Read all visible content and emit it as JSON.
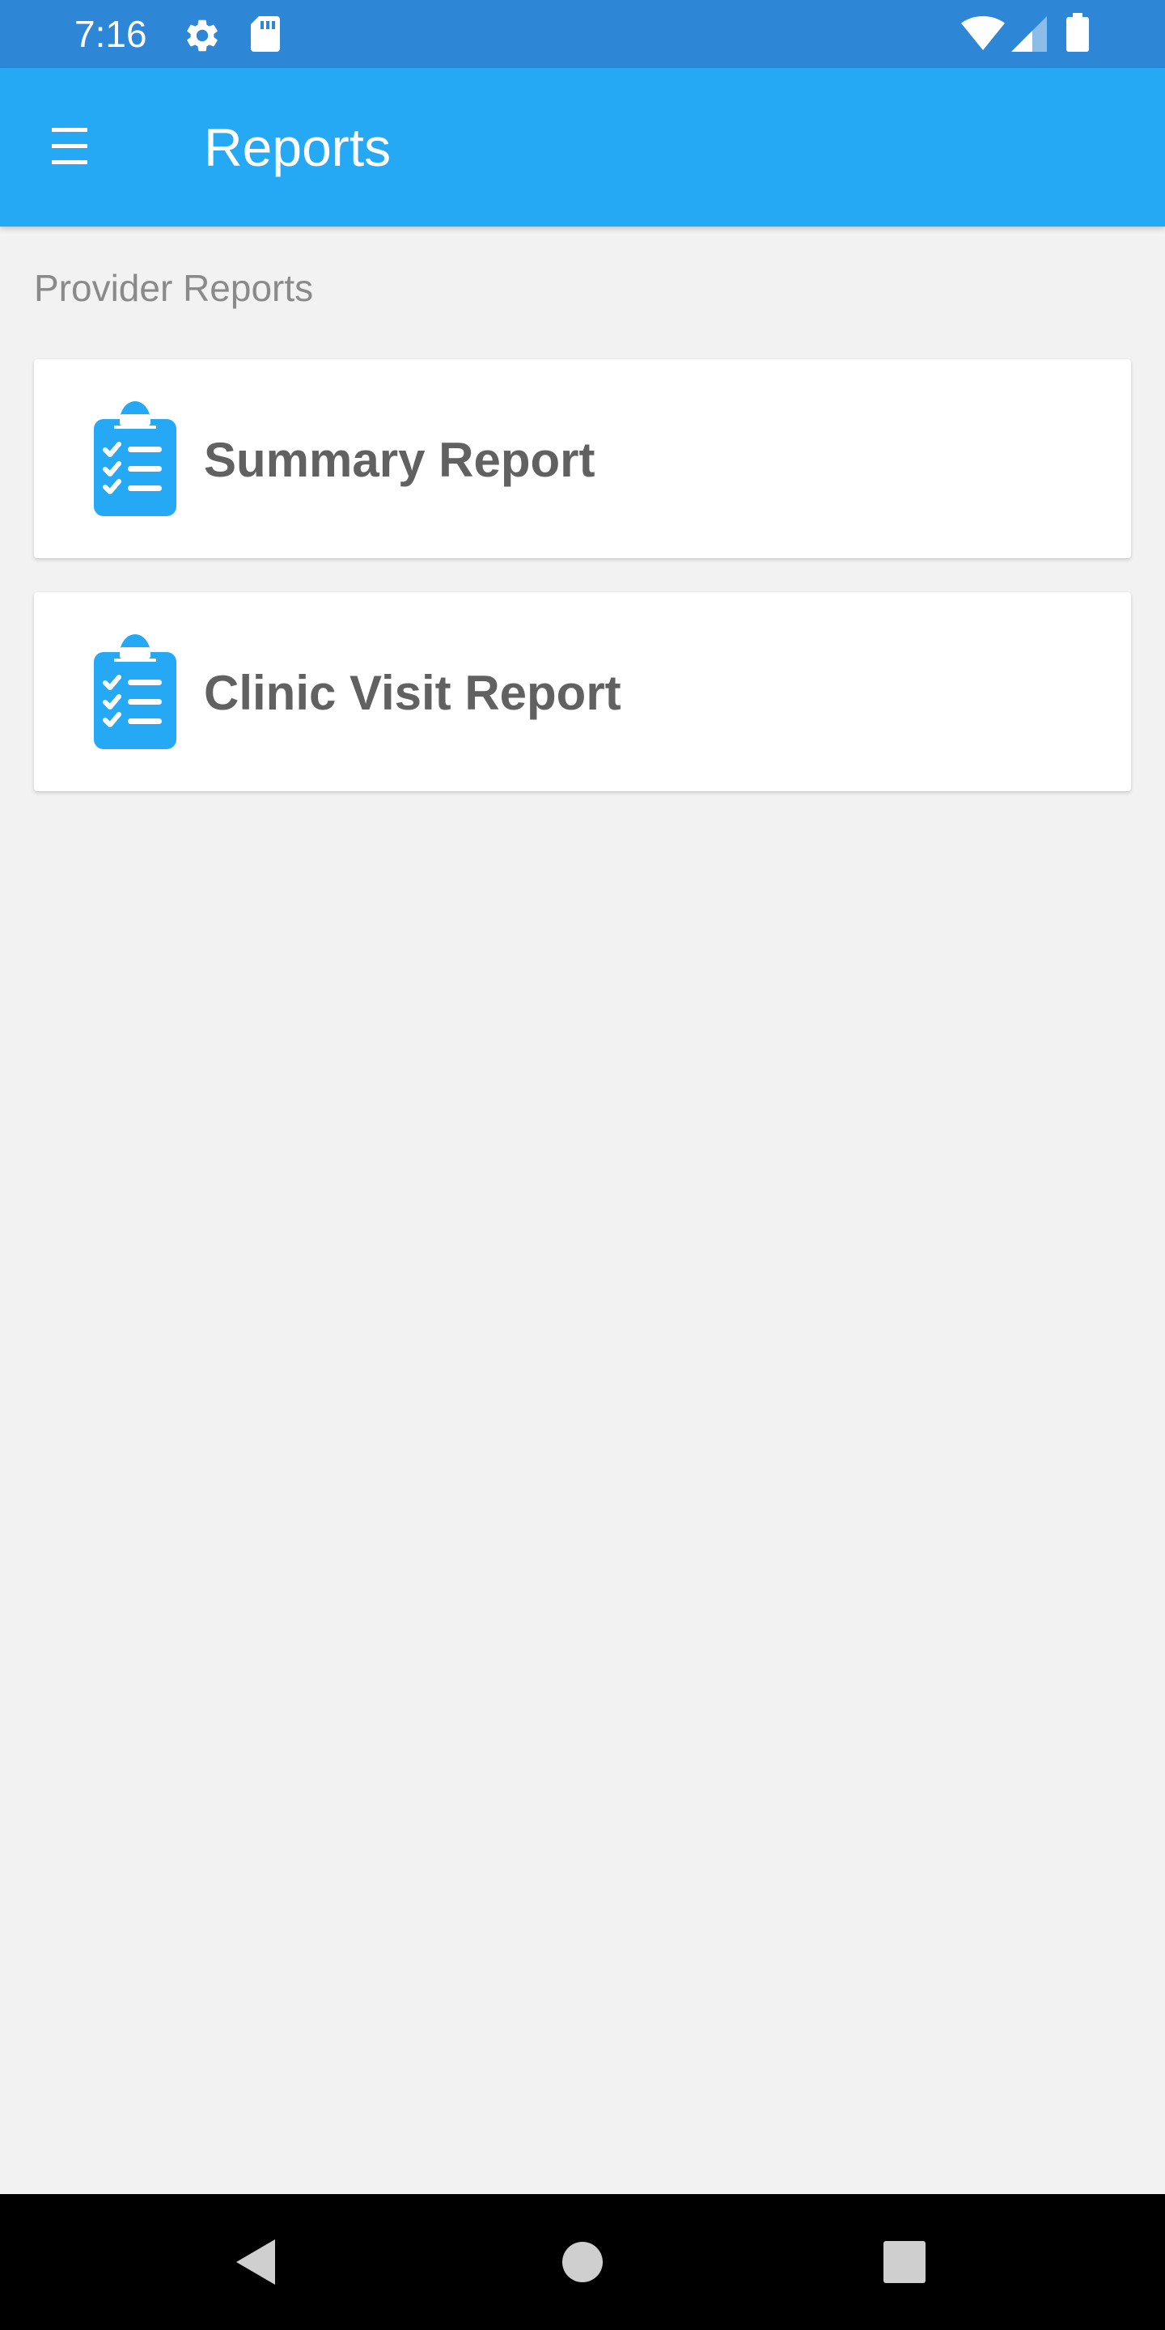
{
  "status_bar": {
    "time": "7:16",
    "icons": [
      "settings-icon",
      "sd-card-icon",
      "wifi-icon",
      "signal-icon",
      "battery-icon"
    ]
  },
  "app_bar": {
    "title": "Reports",
    "menu_icon": "hamburger-menu-icon"
  },
  "section": {
    "heading": "Provider Reports"
  },
  "reports": [
    {
      "label": "Summary Report",
      "icon": "clipboard-checklist-icon"
    },
    {
      "label": "Clinic Visit Report",
      "icon": "clipboard-checklist-icon"
    }
  ],
  "nav_bar": {
    "icons": [
      "back-icon",
      "home-icon",
      "recents-icon"
    ]
  },
  "colors": {
    "status_bar": "#2e86d6",
    "app_bar": "#26a9f5",
    "accent": "#26a9f5",
    "background": "#f2f2f2",
    "card_text": "#616161",
    "section_text": "#8a8a8a"
  }
}
